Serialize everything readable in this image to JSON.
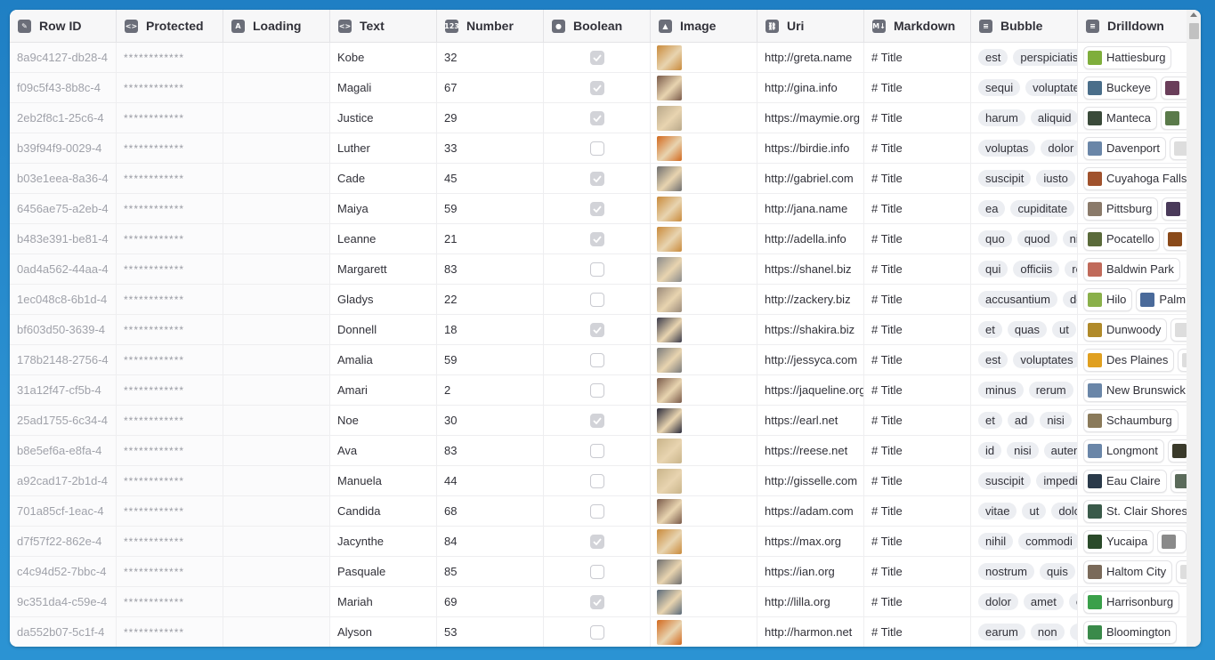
{
  "columns": [
    {
      "label": "Row ID",
      "icon": "row-id-icon",
      "glyph": "✎"
    },
    {
      "label": "Protected",
      "icon": "code-icon",
      "glyph": "<>"
    },
    {
      "label": "Loading",
      "icon": "text-a-icon",
      "glyph": "A"
    },
    {
      "label": "Text",
      "icon": "code-icon",
      "glyph": "<>"
    },
    {
      "label": "Number",
      "icon": "number-icon",
      "glyph": "123"
    },
    {
      "label": "Boolean",
      "icon": "toggle-icon",
      "glyph": "●"
    },
    {
      "label": "Image",
      "icon": "image-icon",
      "glyph": "▲"
    },
    {
      "label": "Uri",
      "icon": "link-icon",
      "glyph": "⛓"
    },
    {
      "label": "Markdown",
      "icon": "markdown-icon",
      "glyph": "M↓"
    },
    {
      "label": "Bubble",
      "icon": "list-icon",
      "glyph": "≡"
    },
    {
      "label": "Drilldown",
      "icon": "list-icon",
      "glyph": "≡"
    }
  ],
  "rows": [
    {
      "id": "8a9c4127-db28-4",
      "protected": "************",
      "text": "Kobe",
      "number": "32",
      "bool": true,
      "image_color": "#c98a3b",
      "uri": "http://greta.name",
      "markdown": "# Title",
      "bubbles": [
        "est",
        "perspiciatis"
      ],
      "drill": [
        {
          "label": "Hattiesburg",
          "color": "#7fae3c"
        }
      ]
    },
    {
      "id": "f09c5f43-8b8c-4",
      "protected": "************",
      "text": "Magali",
      "number": "67",
      "bool": true,
      "image_color": "#7a5a4a",
      "uri": "http://gina.info",
      "markdown": "# Title",
      "bubbles": [
        "sequi",
        "voluptatem"
      ],
      "drill": [
        {
          "label": "Buckeye",
          "color": "#4a6e8a"
        },
        {
          "label": "",
          "color": "#6a3e5a"
        }
      ]
    },
    {
      "id": "2eb2f8c1-25c6-4",
      "protected": "************",
      "text": "Justice",
      "number": "29",
      "bool": true,
      "image_color": "#b9a88a",
      "uri": "https://maymie.org",
      "markdown": "# Title",
      "bubbles": [
        "harum",
        "aliquid"
      ],
      "drill": [
        {
          "label": "Manteca",
          "color": "#3a4a3a"
        },
        {
          "label": "",
          "color": "#5a7a4a"
        }
      ]
    },
    {
      "id": "b39f94f9-0029-4",
      "protected": "************",
      "text": "Luther",
      "number": "33",
      "bool": false,
      "image_color": "#d2691e",
      "uri": "https://birdie.info",
      "markdown": "# Title",
      "bubbles": [
        "voluptas",
        "dolor"
      ],
      "drill": [
        {
          "label": "Davenport",
          "color": "#6a86a8"
        },
        {
          "label": "",
          "color": "#ddd"
        }
      ]
    },
    {
      "id": "b03e1eea-8a36-4",
      "protected": "************",
      "text": "Cade",
      "number": "45",
      "bool": true,
      "image_color": "#6e6e6e",
      "uri": "http://gabriel.com",
      "markdown": "# Title",
      "bubbles": [
        "suscipit",
        "iusto"
      ],
      "drill": [
        {
          "label": "Cuyahoga Falls",
          "color": "#a0522d"
        }
      ]
    },
    {
      "id": "6456ae75-a2eb-4",
      "protected": "************",
      "text": "Maiya",
      "number": "59",
      "bool": true,
      "image_color": "#c98a3b",
      "uri": "http://jana.name",
      "markdown": "# Title",
      "bubbles": [
        "ea",
        "cupiditate"
      ],
      "drill": [
        {
          "label": "Pittsburg",
          "color": "#8a7a6a"
        },
        {
          "label": "",
          "color": "#4a3a5a"
        }
      ]
    },
    {
      "id": "b483e391-be81-4",
      "protected": "************",
      "text": "Leanne",
      "number": "21",
      "bool": true,
      "image_color": "#c98a3b",
      "uri": "http://adella.info",
      "markdown": "# Title",
      "bubbles": [
        "quo",
        "quod",
        "nisi"
      ],
      "drill": [
        {
          "label": "Pocatello",
          "color": "#5a6a3a"
        },
        {
          "label": "",
          "color": "#8a4a1a"
        }
      ]
    },
    {
      "id": "0ad4a562-44aa-4",
      "protected": "************",
      "text": "Margarett",
      "number": "83",
      "bool": false,
      "image_color": "#8a8a8a",
      "uri": "https://shanel.biz",
      "markdown": "# Title",
      "bubbles": [
        "qui",
        "officiis",
        "rerum"
      ],
      "drill": [
        {
          "label": "Baldwin Park",
          "color": "#c06a5a"
        }
      ]
    },
    {
      "id": "1ec048c8-6b1d-4",
      "protected": "************",
      "text": "Gladys",
      "number": "22",
      "bool": false,
      "image_color": "#9a8a7a",
      "uri": "http://zackery.biz",
      "markdown": "# Title",
      "bubbles": [
        "accusantium",
        "dolor"
      ],
      "drill": [
        {
          "label": "Hilo",
          "color": "#8ab04a"
        },
        {
          "label": "Palm",
          "color": "#4a6a9a"
        }
      ]
    },
    {
      "id": "bf603d50-3639-4",
      "protected": "************",
      "text": "Donnell",
      "number": "18",
      "bool": true,
      "image_color": "#3a3a4a",
      "uri": "https://shakira.biz",
      "markdown": "# Title",
      "bubbles": [
        "et",
        "quas",
        "ut"
      ],
      "drill": [
        {
          "label": "Dunwoody",
          "color": "#b08a2a"
        },
        {
          "label": "",
          "color": "#ddd"
        }
      ]
    },
    {
      "id": "178b2148-2756-4",
      "protected": "************",
      "text": "Amalia",
      "number": "59",
      "bool": false,
      "image_color": "#7a7a7a",
      "uri": "http://jessyca.com",
      "markdown": "# Title",
      "bubbles": [
        "est",
        "voluptates"
      ],
      "drill": [
        {
          "label": "Des Plaines",
          "color": "#e0a020"
        },
        {
          "label": "",
          "color": "#ddd"
        }
      ]
    },
    {
      "id": "31a12f47-cf5b-4",
      "protected": "************",
      "text": "Amari",
      "number": "2",
      "bool": false,
      "image_color": "#7a5a4a",
      "uri": "https://jaqueline.org",
      "markdown": "# Title",
      "bubbles": [
        "minus",
        "rerum"
      ],
      "drill": [
        {
          "label": "New Brunswick",
          "color": "#6a86a8"
        }
      ]
    },
    {
      "id": "25ad1755-6c34-4",
      "protected": "************",
      "text": "Noe",
      "number": "30",
      "bool": true,
      "image_color": "#2a2a3a",
      "uri": "https://earl.net",
      "markdown": "# Title",
      "bubbles": [
        "et",
        "ad",
        "nisi"
      ],
      "drill": [
        {
          "label": "Schaumburg",
          "color": "#8a7a5a"
        }
      ]
    },
    {
      "id": "b8e5ef6a-e8fa-4",
      "protected": "************",
      "text": "Ava",
      "number": "83",
      "bool": false,
      "image_color": "#c9b48a",
      "uri": "https://reese.net",
      "markdown": "# Title",
      "bubbles": [
        "id",
        "nisi",
        "autem"
      ],
      "drill": [
        {
          "label": "Longmont",
          "color": "#6a86a8"
        },
        {
          "label": "",
          "color": "#3a3a2a"
        }
      ]
    },
    {
      "id": "a92cad17-2b1d-4",
      "protected": "************",
      "text": "Manuela",
      "number": "44",
      "bool": false,
      "image_color": "#c9b48a",
      "uri": "http://gisselle.com",
      "markdown": "# Title",
      "bubbles": [
        "suscipit",
        "impedit"
      ],
      "drill": [
        {
          "label": "Eau Claire",
          "color": "#2a3a4a"
        },
        {
          "label": "",
          "color": "#5a6a5a"
        }
      ]
    },
    {
      "id": "701a85cf-1eac-4",
      "protected": "************",
      "text": "Candida",
      "number": "68",
      "bool": false,
      "image_color": "#7a5a4a",
      "uri": "https://adam.com",
      "markdown": "# Title",
      "bubbles": [
        "vitae",
        "ut",
        "dolor"
      ],
      "drill": [
        {
          "label": "St. Clair Shores",
          "color": "#3a5a4a"
        }
      ]
    },
    {
      "id": "d7f57f22-862e-4",
      "protected": "************",
      "text": "Jacynthe",
      "number": "84",
      "bool": true,
      "image_color": "#c98a3b",
      "uri": "https://max.org",
      "markdown": "# Title",
      "bubbles": [
        "nihil",
        "commodi"
      ],
      "drill": [
        {
          "label": "Yucaipa",
          "color": "#2a4a2a"
        },
        {
          "label": "",
          "color": "#8a8a8a"
        }
      ]
    },
    {
      "id": "c4c94d52-7bbc-4",
      "protected": "************",
      "text": "Pasquale",
      "number": "85",
      "bool": false,
      "image_color": "#6e6e6e",
      "uri": "https://ian.org",
      "markdown": "# Title",
      "bubbles": [
        "nostrum",
        "quis"
      ],
      "drill": [
        {
          "label": "Haltom City",
          "color": "#7a6a5a"
        },
        {
          "label": "",
          "color": "#ddd"
        }
      ]
    },
    {
      "id": "9c351da4-c59e-4",
      "protected": "************",
      "text": "Mariah",
      "number": "69",
      "bool": true,
      "image_color": "#5a6a7a",
      "uri": "http://lilla.org",
      "markdown": "# Title",
      "bubbles": [
        "dolor",
        "amet",
        "et"
      ],
      "drill": [
        {
          "label": "Harrisonburg",
          "color": "#3aa04a"
        }
      ]
    },
    {
      "id": "da552b07-5c1f-4",
      "protected": "************",
      "text": "Alyson",
      "number": "53",
      "bool": false,
      "image_color": "#d2691e",
      "uri": "http://harmon.net",
      "markdown": "# Title",
      "bubbles": [
        "earum",
        "non",
        "nisi"
      ],
      "drill": [
        {
          "label": "Bloomington",
          "color": "#3a8a4a"
        }
      ]
    }
  ]
}
